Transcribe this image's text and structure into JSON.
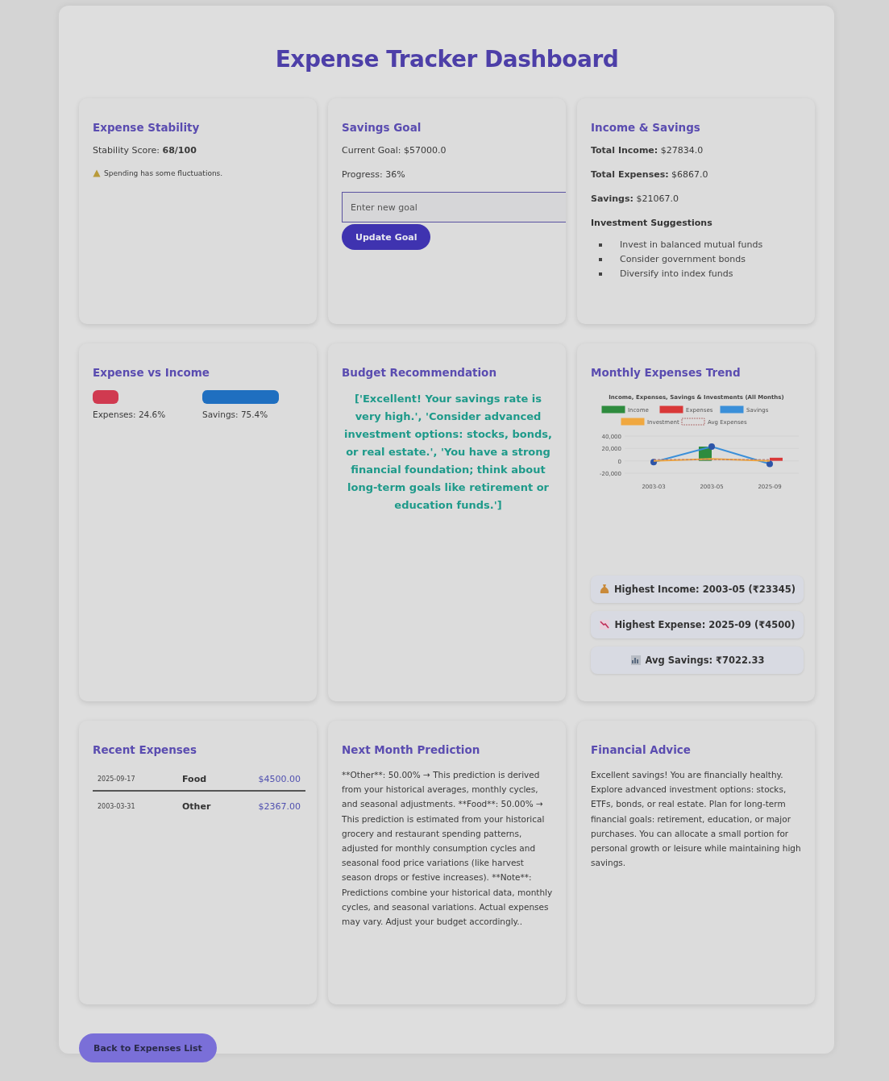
{
  "title": "Expense Tracker Dashboard",
  "expense_stability": {
    "heading": "Expense Stability",
    "score_label": "Stability Score:",
    "score": "68/100",
    "warning": "Spending has some fluctuations."
  },
  "savings_goal": {
    "heading": "Savings Goal",
    "current_goal": "Current Goal: $57000.0",
    "progress": "Progress: 36%",
    "goal_input": {
      "placeholder": "Enter new goal"
    },
    "button": "Update Goal"
  },
  "income_savings": {
    "heading": "Income & Savings",
    "lines": [
      {
        "label": "Total Income:",
        "value": "$27834.0"
      },
      {
        "label": "Total Expenses:",
        "value": "$6867.0"
      },
      {
        "label": "Savings:",
        "value": "$21067.0"
      }
    ],
    "suggestions_heading": "Investment Suggestions",
    "suggestions": [
      "Invest in balanced mutual funds",
      "Consider government bonds",
      "Diversify into index funds"
    ]
  },
  "expense_vs_income": {
    "heading": "Expense vs Income",
    "bars": [
      {
        "kind": "expenses",
        "label": "Expenses: 24.6%"
      },
      {
        "kind": "savings",
        "label": "Savings: 75.4%"
      }
    ]
  },
  "budget_recommendation": {
    "heading": "Budget Recommendation",
    "text": "['Excellent! Your savings rate is very high.', 'Consider advanced investment options: stocks, bonds, or real estate.', 'You have a strong financial foundation; think about long-term goals like retirement or education funds.']"
  },
  "monthly_trend": {
    "heading": "Monthly Expenses Trend",
    "chart_data": {
      "type": "bar",
      "stacked": false,
      "legend": "top",
      "title": "Income, Expenses, Savings & Investments (All Months)",
      "categories": [
        "2003-03",
        "2003-05",
        "2025-09"
      ],
      "ylim": [
        -20000,
        40000
      ],
      "yticks": [
        {
          "value": 40000,
          "label": "40,000"
        },
        {
          "value": 20000,
          "label": "20,000"
        },
        {
          "value": 0,
          "label": "0"
        },
        {
          "value": -20000,
          "label": "-20,000"
        }
      ],
      "series": [
        {
          "name": "Income",
          "color": "#2e8b3e",
          "type": "bar",
          "values": [
            0,
            23000,
            0
          ]
        },
        {
          "name": "Expenses",
          "color": "#d93838",
          "type": "bar",
          "values": [
            null,
            0,
            5000
          ]
        },
        {
          "name": "Savings",
          "color": "#3a8fd9",
          "type": "line",
          "marker": "circle",
          "values": [
            -2000,
            23000,
            -5000
          ]
        },
        {
          "name": "Investment",
          "color": "#f0a840",
          "type": "line",
          "values": [
            0,
            3000,
            0
          ]
        },
        {
          "name": "Avg Expenses",
          "color": "#b07070",
          "type": "line",
          "line_style": "dashed",
          "values": [
            2000,
            2000,
            2000
          ]
        }
      ]
    },
    "stats": [
      {
        "kind": "income",
        "text": "Highest Income: 2003-05 (₹23345)"
      },
      {
        "kind": "expense",
        "text": "Highest Expense: 2025-09 (₹4500)"
      },
      {
        "kind": "savings",
        "text": "Avg Savings: ₹7022.33"
      }
    ]
  },
  "recent_expenses": {
    "heading": "Recent Expenses",
    "rows": [
      {
        "date": "2025-09-17",
        "category": "Food",
        "amount": "$4500.00"
      },
      {
        "date": "2003-03-31",
        "category": "Other",
        "amount": "$2367.00"
      }
    ]
  },
  "prediction": {
    "heading": "Next Month Prediction",
    "text": "**Other**: 50.00% → This prediction is derived from your historical averages, monthly cycles, and seasonal adjustments. **Food**: 50.00% → This prediction is estimated from your historical grocery and restaurant spending patterns, adjusted for monthly consumption cycles and seasonal food price variations (like harvest season drops or festive increases). **Note**: Predictions combine your historical data, monthly cycles, and seasonal variations. Actual expenses may vary. Adjust your budget accordingly.."
  },
  "financial_advice": {
    "heading": "Financial Advice",
    "text": "Excellent savings! You are financially healthy. Explore advanced investment options: stocks, ETFs, bonds, or real estate. Plan for long-term financial goals: retirement, education, or major purchases. You can allocate a small portion for personal growth or leisure while maintaining high savings."
  },
  "back_button": "Back to Expenses List"
}
